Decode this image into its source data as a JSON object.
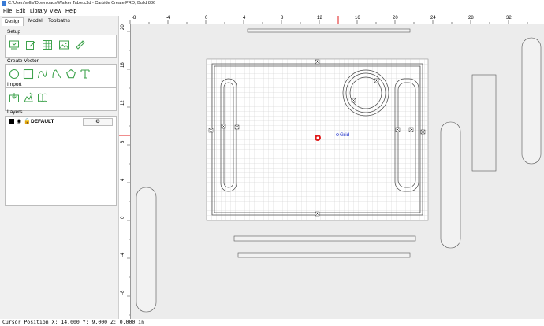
{
  "window": {
    "title": "C:\\Users\\wllis\\Downloads\\Walker Table.c2d - Carbide Create PRO, Build 836"
  },
  "menu": [
    "File",
    "Edit",
    "Library",
    "View",
    "Help"
  ],
  "tabs": [
    "Design",
    "Model",
    "Toolpaths"
  ],
  "sections": {
    "setup": "Setup",
    "create_vector": "Create Vector",
    "import": "Import",
    "layers": "Layers"
  },
  "setup_tools": [
    "job-setup-icon",
    "edit-icon",
    "grid-icon",
    "image-icon",
    "measure-icon"
  ],
  "vector_tools": [
    "circle-icon",
    "rectangle-icon",
    "curve-icon",
    "polyline-icon",
    "polygon-icon",
    "text-icon"
  ],
  "import_tools": [
    "import-vector-icon",
    "import-image-icon",
    "library-book-icon"
  ],
  "layers": [
    {
      "name": "DEFAULT",
      "color": "#000000"
    }
  ],
  "ruler": {
    "top_ticks": [
      "-8",
      "-4",
      "0",
      "4",
      "8",
      "12",
      "16",
      "20",
      "24",
      "28",
      "32"
    ],
    "left_ticks": [
      "20",
      "16",
      "12",
      "8",
      "4",
      "0",
      "-4",
      "-8"
    ]
  },
  "canvas": {
    "grid_label": "Grid"
  },
  "status": {
    "cursor": "Cursor Position X: 14.000 Y: 9.000 Z: 0.000 in"
  },
  "colors": {
    "accent_green": "#3fa34d",
    "marker_red": "#e01b1b",
    "grid_blue": "#2233cc"
  }
}
